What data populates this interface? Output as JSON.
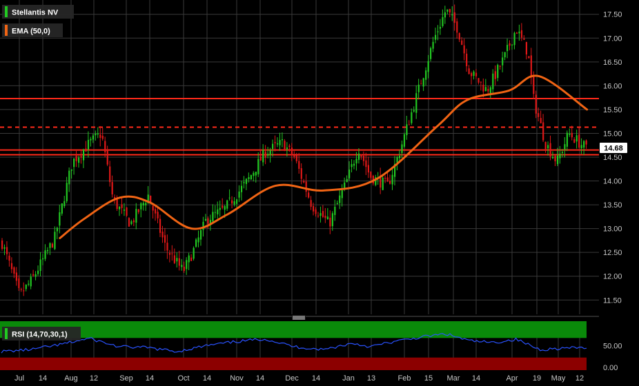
{
  "legend": {
    "instrument": "Stellantis NV",
    "ema": "EMA (50,0)",
    "rsi": "RSI (14,70,30,1)"
  },
  "colors": {
    "background": "#000000",
    "grid": "#3a3a3a",
    "up": "#22c922",
    "down": "#e01818",
    "ema": "#f06414",
    "level": "#ff2a1a",
    "rsi_line": "#2a52ff",
    "overbought": "#0a8a0a",
    "oversold": "#8c0000",
    "axis_text": "#c8c8c8",
    "price_tag_bg": "#ffffff"
  },
  "chart_data": [
    {
      "type": "candlestick",
      "title": "Stellantis NV",
      "ylim": [
        11.2,
        17.8
      ],
      "y_ticks": [
        "11.50",
        "12.00",
        "12.50",
        "13.00",
        "13.50",
        "14.00",
        "14.50",
        "15.00",
        "15.50",
        "16.00",
        "16.50",
        "17.00",
        "17.50"
      ],
      "x_ticks": [
        "Jul",
        "14",
        "Aug",
        "12",
        "Sep",
        "14",
        "Oct",
        "14",
        "Nov",
        "14",
        "Dec",
        "14",
        "Jan",
        "13",
        "Feb",
        "15",
        "Mar",
        "14",
        "Apr",
        "19",
        "May",
        "12"
      ],
      "last_price": "14.68",
      "horizontal_levels": [
        {
          "value": 15.73,
          "style": "solid"
        },
        {
          "value": 15.13,
          "style": "dashed"
        },
        {
          "value": 14.65,
          "style": "solid"
        },
        {
          "value": 14.55,
          "style": "solid"
        }
      ],
      "ema_50": [
        {
          "x": 0.1,
          "y": 12.8
        },
        {
          "x": 0.14,
          "y": 13.2
        },
        {
          "x": 0.2,
          "y": 13.65
        },
        {
          "x": 0.25,
          "y": 13.55
        },
        {
          "x": 0.32,
          "y": 13.0
        },
        {
          "x": 0.38,
          "y": 13.3
        },
        {
          "x": 0.46,
          "y": 13.9
        },
        {
          "x": 0.54,
          "y": 13.8
        },
        {
          "x": 0.63,
          "y": 14.05
        },
        {
          "x": 0.73,
          "y": 15.15
        },
        {
          "x": 0.78,
          "y": 15.7
        },
        {
          "x": 0.85,
          "y": 15.9
        },
        {
          "x": 0.9,
          "y": 16.2
        },
        {
          "x": 0.98,
          "y": 15.5
        }
      ],
      "price_path": [
        {
          "x": 0.0,
          "y": 12.7
        },
        {
          "x": 0.03,
          "y": 11.6
        },
        {
          "x": 0.05,
          "y": 11.9
        },
        {
          "x": 0.09,
          "y": 12.8
        },
        {
          "x": 0.12,
          "y": 14.4
        },
        {
          "x": 0.15,
          "y": 14.8
        },
        {
          "x": 0.17,
          "y": 15.0
        },
        {
          "x": 0.19,
          "y": 13.6
        },
        {
          "x": 0.22,
          "y": 13.1
        },
        {
          "x": 0.25,
          "y": 13.7
        },
        {
          "x": 0.28,
          "y": 12.6
        },
        {
          "x": 0.31,
          "y": 12.1
        },
        {
          "x": 0.33,
          "y": 12.6
        },
        {
          "x": 0.35,
          "y": 13.2
        },
        {
          "x": 0.38,
          "y": 13.4
        },
        {
          "x": 0.42,
          "y": 14.0
        },
        {
          "x": 0.45,
          "y": 14.6
        },
        {
          "x": 0.48,
          "y": 14.8
        },
        {
          "x": 0.5,
          "y": 14.5
        },
        {
          "x": 0.53,
          "y": 13.5
        },
        {
          "x": 0.56,
          "y": 13.1
        },
        {
          "x": 0.59,
          "y": 14.0
        },
        {
          "x": 0.61,
          "y": 14.7
        },
        {
          "x": 0.63,
          "y": 14.1
        },
        {
          "x": 0.66,
          "y": 13.9
        },
        {
          "x": 0.68,
          "y": 14.6
        },
        {
          "x": 0.7,
          "y": 15.4
        },
        {
          "x": 0.72,
          "y": 16.2
        },
        {
          "x": 0.74,
          "y": 17.0
        },
        {
          "x": 0.76,
          "y": 17.6
        },
        {
          "x": 0.78,
          "y": 17.2
        },
        {
          "x": 0.8,
          "y": 16.3
        },
        {
          "x": 0.83,
          "y": 15.9
        },
        {
          "x": 0.86,
          "y": 16.6
        },
        {
          "x": 0.88,
          "y": 17.2
        },
        {
          "x": 0.9,
          "y": 16.7
        },
        {
          "x": 0.91,
          "y": 15.7
        },
        {
          "x": 0.93,
          "y": 14.8
        },
        {
          "x": 0.95,
          "y": 14.4
        },
        {
          "x": 0.97,
          "y": 15.0
        },
        {
          "x": 1.0,
          "y": 14.68
        }
      ]
    },
    {
      "type": "line",
      "title": "RSI (14,70,30,1)",
      "ylim": [
        0,
        100
      ],
      "y_ticks": [
        "0.00",
        "50.00"
      ],
      "overbought": 70,
      "oversold": 30,
      "rsi": [
        {
          "x": 0.0,
          "y": 38
        },
        {
          "x": 0.05,
          "y": 42
        },
        {
          "x": 0.1,
          "y": 52
        },
        {
          "x": 0.15,
          "y": 65
        },
        {
          "x": 0.2,
          "y": 48
        },
        {
          "x": 0.25,
          "y": 46
        },
        {
          "x": 0.3,
          "y": 38
        },
        {
          "x": 0.35,
          "y": 50
        },
        {
          "x": 0.4,
          "y": 58
        },
        {
          "x": 0.45,
          "y": 64
        },
        {
          "x": 0.5,
          "y": 48
        },
        {
          "x": 0.55,
          "y": 42
        },
        {
          "x": 0.6,
          "y": 55
        },
        {
          "x": 0.63,
          "y": 48
        },
        {
          "x": 0.67,
          "y": 58
        },
        {
          "x": 0.72,
          "y": 68
        },
        {
          "x": 0.76,
          "y": 74
        },
        {
          "x": 0.8,
          "y": 60
        },
        {
          "x": 0.84,
          "y": 56
        },
        {
          "x": 0.88,
          "y": 63
        },
        {
          "x": 0.92,
          "y": 42
        },
        {
          "x": 0.96,
          "y": 45
        },
        {
          "x": 1.0,
          "y": 46
        }
      ]
    }
  ]
}
